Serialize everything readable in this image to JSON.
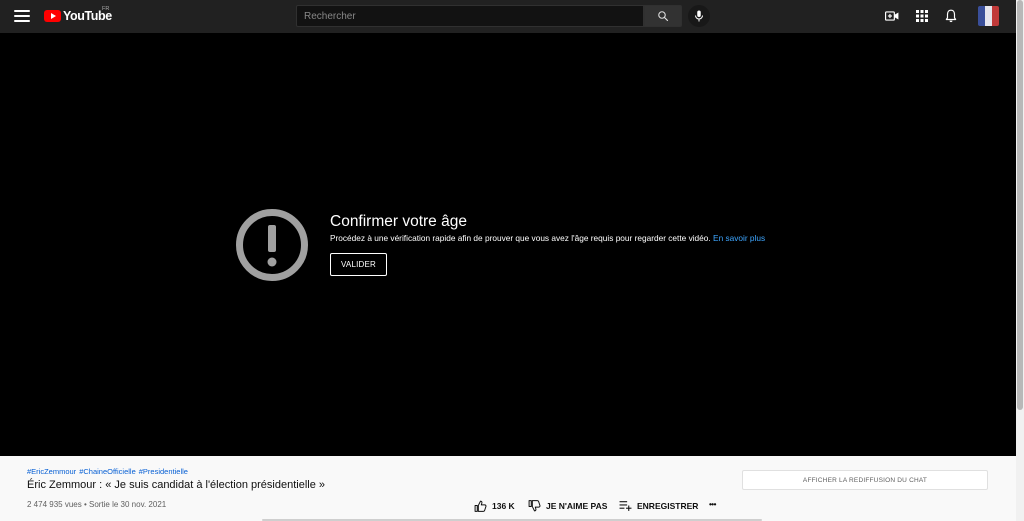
{
  "header": {
    "logo_text": "YouTube",
    "country_code": "FR",
    "search_placeholder": "Rechercher"
  },
  "player": {
    "age_gate": {
      "title": "Confirmer votre âge",
      "description": "Procédez à une vérification rapide afin de prouver que vous avez l'âge requis pour regarder cette vidéo.",
      "learn_more": "En savoir plus",
      "button_label": "VALIDER"
    }
  },
  "video": {
    "hashtags": [
      "#EricZemmour",
      "#ChaineOfficielle",
      "#Presidentielle"
    ],
    "title": "Éric Zemmour : « Je suis candidat à l'élection présidentielle »",
    "views": "2 474 935 vues",
    "date": "Sortie le 30 nov. 2021"
  },
  "actions": {
    "like_count": "136 K",
    "dislike_label": "JE N'AIME PAS",
    "save_label": "ENREGISTRER",
    "more_label": "•••"
  },
  "chat": {
    "replay_label": "AFFICHER LA REDIFFUSION DU CHAT"
  },
  "colors": {
    "brand_red": "#ff0000",
    "link_blue": "#3ea6ff",
    "hashtag_blue": "#065fd4",
    "header_bg": "#212121"
  }
}
